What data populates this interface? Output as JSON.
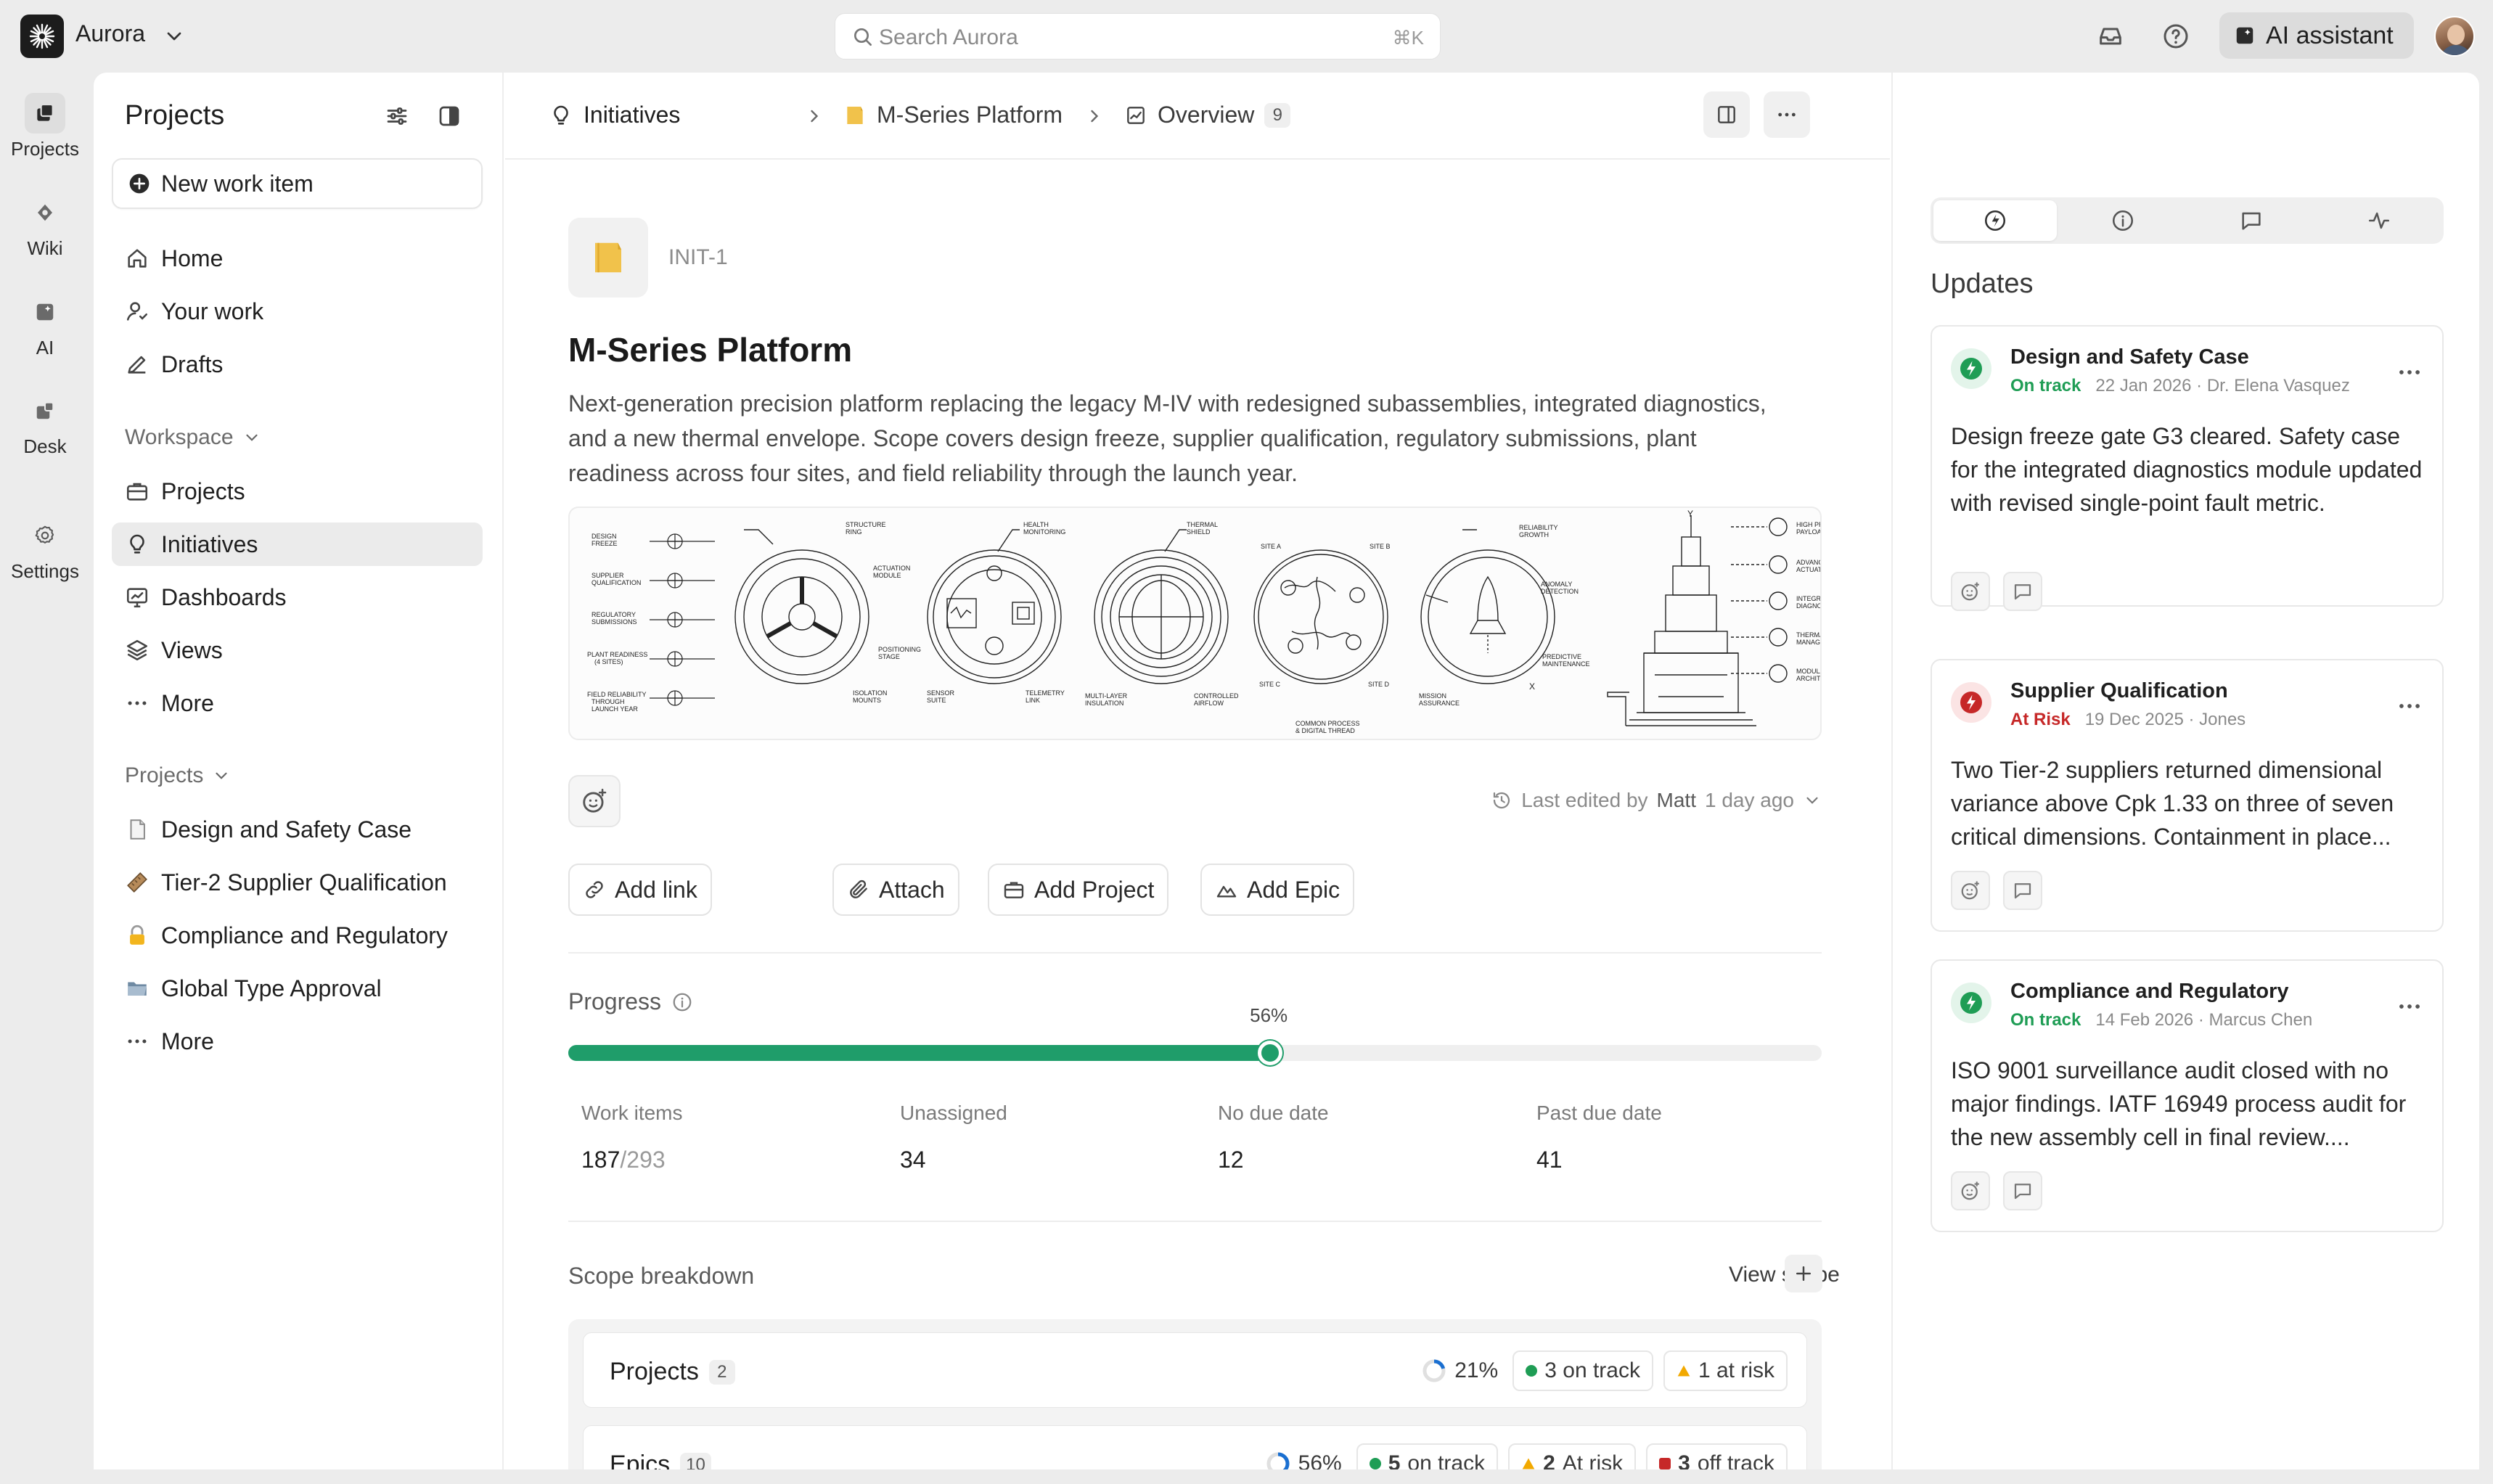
{
  "app": {
    "workspace_name": "Aurora",
    "search_placeholder": "Search Aurora",
    "search_shortcut": "⌘K",
    "ai_assistant_label": "AI assistant"
  },
  "rail": [
    {
      "label": "Projects",
      "icon": "projects-icon",
      "active": true
    },
    {
      "label": "Wiki",
      "icon": "wiki-icon"
    },
    {
      "label": "AI",
      "icon": "ai-icon"
    },
    {
      "label": "Desk",
      "icon": "desk-icon"
    },
    {
      "label": "Settings",
      "icon": "settings-icon"
    }
  ],
  "sidebar": {
    "title": "Projects",
    "new_item_label": "New work item",
    "main_nav": [
      {
        "label": "Home",
        "icon": "home-icon"
      },
      {
        "label": "Your work",
        "icon": "user-icon"
      },
      {
        "label": "Drafts",
        "icon": "pencil-icon"
      }
    ],
    "workspace_label": "Workspace",
    "workspace_nav": [
      {
        "label": "Projects",
        "icon": "briefcase-icon"
      },
      {
        "label": "Initiatives",
        "icon": "lightbulb-icon",
        "active": true
      },
      {
        "label": "Dashboards",
        "icon": "dashboard-icon"
      },
      {
        "label": "Views",
        "icon": "layers-icon"
      },
      {
        "label": "More",
        "icon": "ellipsis-icon"
      }
    ],
    "projects_label": "Projects",
    "projects_nav": [
      {
        "label": "Design and Safety Case",
        "icon": "document-emoji-icon"
      },
      {
        "label": "Tier-2 Supplier Qualification",
        "icon": "ruler-emoji-icon"
      },
      {
        "label": "Compliance and Regulatory",
        "icon": "lock-emoji-icon"
      },
      {
        "label": "Global Type Approval",
        "icon": "folder-emoji-icon"
      },
      {
        "label": "More",
        "icon": "ellipsis-icon"
      }
    ]
  },
  "breadcrumb": {
    "items": [
      "Initiatives",
      "M-Series Platform",
      "Overview"
    ],
    "overview_count": "9"
  },
  "initiative": {
    "id": "INIT-1",
    "title": "M-Series Platform",
    "description": "Next-generation precision platform replacing the legacy M-IV with redesigned subassemblies, integrated diagnostics, and a new thermal envelope. Scope covers design freeze, supplier qualification, regulatory submissions, plant readiness across four sites, and field reliability through the launch year.",
    "last_edited_prefix": "Last edited by",
    "last_edited_user": "Matt",
    "last_edited_time": "1 day ago",
    "actions": [
      "Add link",
      "Attach",
      "Add Project",
      "Add Epic"
    ]
  },
  "diagram": {
    "left_labels": [
      "DESIGN\nFREEZE",
      "SUPPLIER\nQUALIFICATION",
      "REGULATORY\nSUBMISSIONS",
      "PLANT READINESS\n(4 SITES)",
      "FIELD RELIABILITY\nTHROUGH\nLAUNCH YEAR"
    ],
    "ring_labels": [
      "STRUCTURE\nRING",
      "ACTUATION\nMODULE",
      "POSITIONING\nSTAGE",
      "ISOLATION\nMOUNTS",
      "HEALTH\nMONITORING",
      "SENSOR\nSUITE",
      "TELEMETRY\nLINK",
      "THERMAL\nSHIELD",
      "MULTI-LAYER\nINSULATION",
      "CONTROLLED\nAIRFLOW",
      "SITE A",
      "SITE B",
      "SITE C",
      "SITE D",
      "COMMON PROCESS\n& DIGITAL THREAD",
      "RELIABILITY\nGROWTH",
      "ANOMALY\nDETECTION",
      "PREDICTIVE\nMAINTENANCE",
      "MISSION\nASSURANCE"
    ],
    "right_labels": [
      "HIGH PRECISION\nPAYLOAD INTERFACE",
      "ADVANCED\nACTUATION",
      "INTEGRATED\nDIAGNOSTICS",
      "THERMAL\nMANAGEMENT",
      "MODULAR\nARCHITECTURE"
    ],
    "axis_labels": [
      "Y",
      "X"
    ]
  },
  "progress": {
    "label": "Progress",
    "percent": 56,
    "percent_label": "56%",
    "stats": [
      {
        "label": "Work items",
        "value": "187",
        "total": "/293"
      },
      {
        "label": "Unassigned",
        "value": "34"
      },
      {
        "label": "No due date",
        "value": "12"
      },
      {
        "label": "Past due date",
        "value": "41"
      }
    ]
  },
  "scope": {
    "title": "Scope breakdown",
    "view_label": "View scope",
    "rows": [
      {
        "name": "Projects",
        "count": "2",
        "pct": "21%",
        "pct_value": 21,
        "on_track": "3 on track",
        "at_risk": "1 at risk"
      },
      {
        "name": "Epics",
        "count": "10",
        "pct": "56%",
        "pct_value": 56,
        "on_track_num": "5",
        "on_track_text": " on track",
        "at_risk_num": "2",
        "at_risk_text": " At risk",
        "off_track_num": "3",
        "off_track_text": " off track"
      }
    ]
  },
  "updates": {
    "title": "Updates",
    "cards": [
      {
        "title": "Design and Safety Case",
        "status": "On track",
        "status_color": "#1f9d55",
        "date": "22 Jan 2026 · Dr. Elena Vasquez",
        "body": "Design freeze gate G3 cleared. Safety case for the integrated diagnostics module updated with revised single-point fault metric."
      },
      {
        "title": "Supplier Qualification",
        "status": "At Risk",
        "status_color": "#c62828",
        "date": "19 Dec 2025 · Jones",
        "body": "Two Tier-2 suppliers returned dimensional variance above Cpk 1.33 on three of seven critical dimensions. Containment in place..."
      },
      {
        "title": "Compliance and Regulatory",
        "status": "On track",
        "status_color": "#1f9d55",
        "date": "14 Feb 2026 · Marcus Chen",
        "body": "ISO 9001 surveillance audit closed with no major findings. IATF 16949 process audit for the new assembly cell in final review...."
      }
    ]
  },
  "colors": {
    "accent_green": "#1f9d6a",
    "status_red": "#c62828",
    "status_amber": "#f2a900"
  }
}
